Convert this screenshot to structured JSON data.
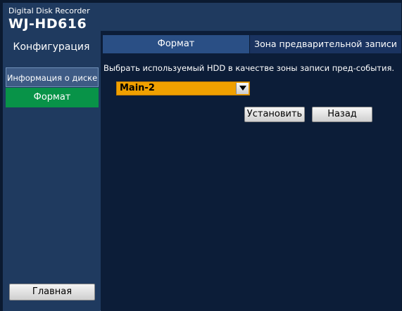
{
  "header": {
    "brand": "Digital Disk Recorder",
    "model": "WJ-HD616"
  },
  "sidebar": {
    "title": "Конфигурация",
    "items": [
      {
        "label": "Информация о диске"
      },
      {
        "label": "Формат"
      }
    ],
    "home_label": "Главная"
  },
  "tabs": [
    {
      "label": "Формат",
      "active": true
    },
    {
      "label": "Зона предварительной записи",
      "active": false
    }
  ],
  "content": {
    "description": "Выбрать используемый HDD в качестве зоны записи пред-события.",
    "select_value": "Main-2",
    "set_label": "Установить",
    "back_label": "Назад"
  },
  "colors": {
    "active_green": "#089348",
    "select_orange": "#f0a000",
    "panel_blue": "#1f3a5f"
  }
}
